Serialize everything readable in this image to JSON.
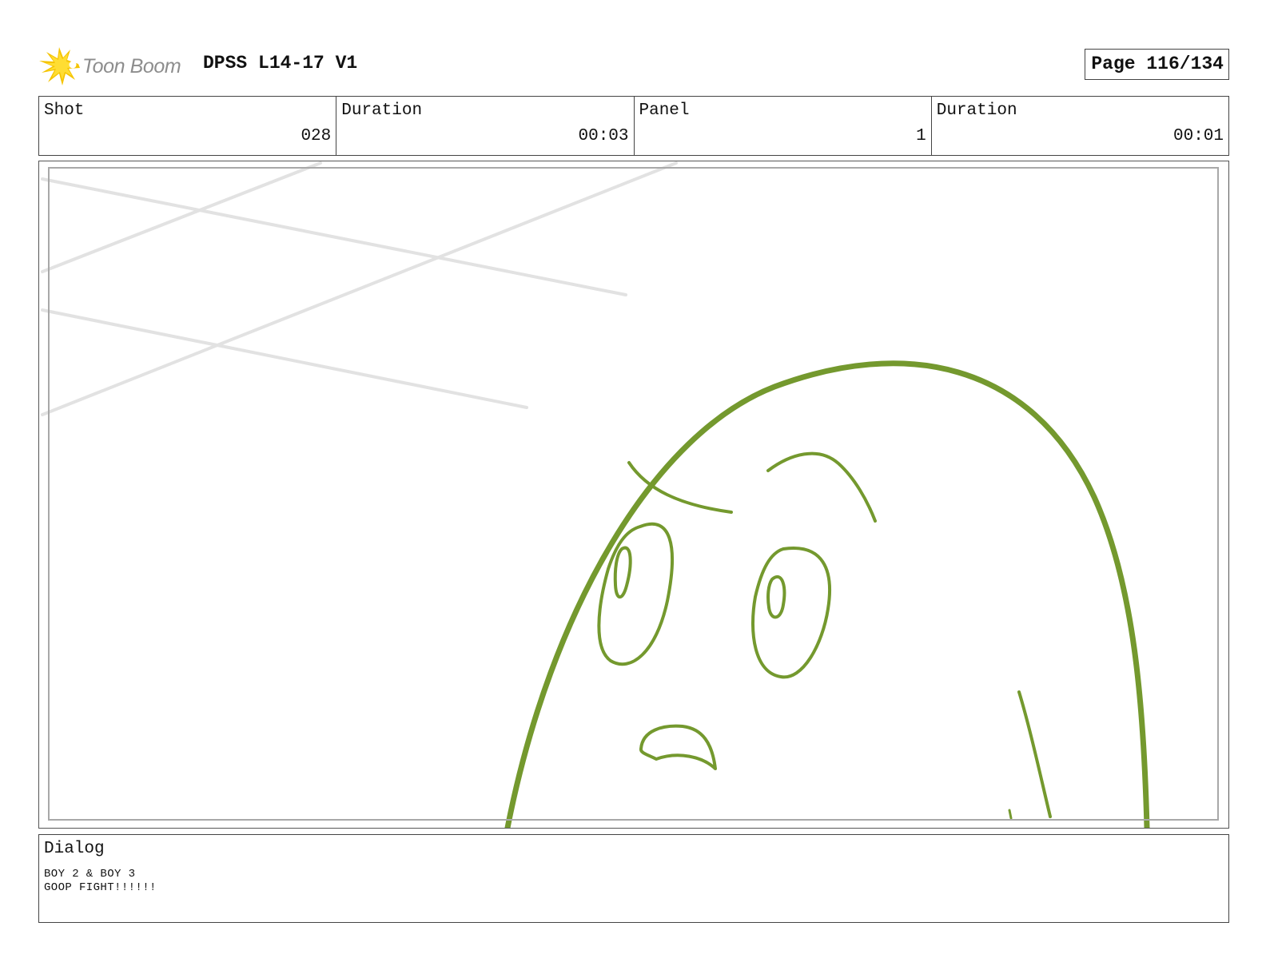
{
  "header": {
    "logo_text": "Toon Boom",
    "project_title": "DPSS L14-17 V1",
    "page_label": "Page 116/134"
  },
  "info": {
    "shot_label": "Shot",
    "shot_value": "028",
    "shot_duration_label": "Duration",
    "shot_duration_value": "00:03",
    "panel_label": "Panel",
    "panel_value": "1",
    "panel_duration_label": "Duration",
    "panel_duration_value": "00:01"
  },
  "dialog": {
    "label": "Dialog",
    "line1": "BOY 2 & BOY 3",
    "line2": "GOOP FIGHT!!!!!!"
  },
  "colors": {
    "sketch_green": "#74992e",
    "light_lines": "#e2e2e2",
    "logo_yellow": "#f5c400",
    "logo_text": "#8d8d8d"
  },
  "icons": {
    "logo": "starburst-logo-icon"
  }
}
